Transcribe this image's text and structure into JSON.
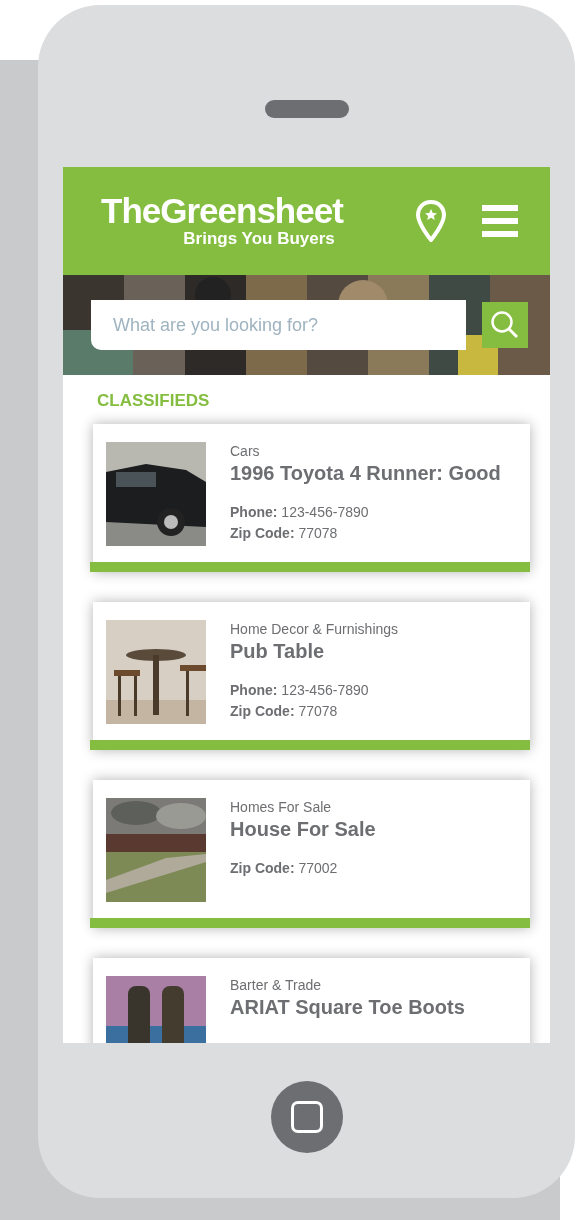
{
  "header": {
    "logo": "TheGreensheet",
    "tagline": "Brings You Buyers"
  },
  "search": {
    "placeholder": "What are you looking for?"
  },
  "section_title": "CLASSIFIEDS",
  "listings": [
    {
      "category": "Cars",
      "title": "1996 Toyota 4 Runner: Good",
      "details": [
        {
          "label": "Phone:",
          "value": "123-456-7890"
        },
        {
          "label": "Zip Code:",
          "value": "77078"
        }
      ]
    },
    {
      "category": "Home Decor & Furnishings",
      "title": "Pub Table",
      "details": [
        {
          "label": "Phone:",
          "value": "123-456-7890"
        },
        {
          "label": "Zip Code:",
          "value": "77078"
        }
      ]
    },
    {
      "category": "Homes For Sale",
      "title": "House For Sale",
      "details": [
        {
          "label": "Zip Code:",
          "value": "77002"
        }
      ]
    },
    {
      "category": "Barter & Trade",
      "title": "ARIAT Square Toe Boots"
    }
  ]
}
